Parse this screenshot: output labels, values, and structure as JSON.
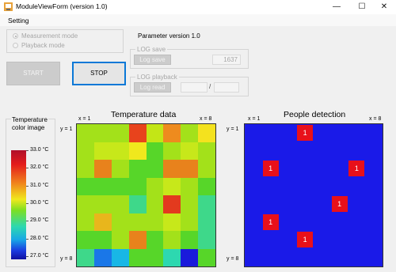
{
  "window": {
    "title": "ModuleViewForm (version 1.0)",
    "minimize": "—",
    "maximize": "☐",
    "close": "✕"
  },
  "menu": {
    "setting": "Setting"
  },
  "mode": {
    "measurement": "Measurement mode",
    "playback": "Playback mode",
    "selected": "measurement"
  },
  "buttons": {
    "start": "START",
    "stop": "STOP"
  },
  "parameter": {
    "version_label": "Parameter version 1.0"
  },
  "log_save": {
    "group": "LOG save",
    "button": "Log save",
    "value": "1637"
  },
  "log_playback": {
    "group": "LOG playback",
    "button": "Log read",
    "current": "",
    "separator": "/",
    "total": ""
  },
  "temperature": {
    "title": "Temperature data",
    "x_start": "x = 1",
    "x_end": "x = 8",
    "y_start": "y = 1",
    "y_end": "y = 8",
    "colors": [
      [
        "#a3e11a",
        "#a3e11a",
        "#a3e11a",
        "#e8431c",
        "#c3e616",
        "#ee8b1e",
        "#a3e11a",
        "#f4e21e"
      ],
      [
        "#a3e11a",
        "#c7e81a",
        "#c7e81a",
        "#f0e81d",
        "#57d629",
        "#a3e11a",
        "#c7e81a",
        "#a3e11a"
      ],
      [
        "#a3e11a",
        "#e8821c",
        "#a3e11a",
        "#57d629",
        "#57d629",
        "#e8821c",
        "#e8821c",
        "#a3e11a"
      ],
      [
        "#57d629",
        "#57d629",
        "#57d629",
        "#57d629",
        "#a3e11a",
        "#c7e81a",
        "#a3e11a",
        "#57d629"
      ],
      [
        "#a3e11a",
        "#a3e11a",
        "#a3e11a",
        "#3ed88a",
        "#a3e11a",
        "#e33a1e",
        "#a3e11a",
        "#3ed88a"
      ],
      [
        "#a3e11a",
        "#e8b61c",
        "#a3e11a",
        "#a3e11a",
        "#a3e11a",
        "#c7e81a",
        "#a3e11a",
        "#3ed88a"
      ],
      [
        "#57d629",
        "#57d629",
        "#a3e11a",
        "#e8821c",
        "#57d629",
        "#a3e11a",
        "#57d629",
        "#3ed88a"
      ],
      [
        "#3ed88a",
        "#1a77e8",
        "#18b7e6",
        "#57d629",
        "#57d629",
        "#2dd8b0",
        "#1a1adb",
        "#57d629"
      ]
    ]
  },
  "legend": {
    "title_line1": "Temperature",
    "title_line2": "color image",
    "ticks": [
      "33.0 °C",
      "32.0 °C",
      "31.0 °C",
      "30.0 °C",
      "29.0 °C",
      "28.0 °C",
      "27.0 °C"
    ]
  },
  "people": {
    "title": "People detection",
    "x_start": "x = 1",
    "x_end": "x = 8",
    "y_start": "y = 1",
    "y_end": "y = 8",
    "background": "#1a1ae8",
    "detections": [
      {
        "row": 1,
        "col": 4,
        "label": "1"
      },
      {
        "row": 3,
        "col": 2,
        "label": "1"
      },
      {
        "row": 3,
        "col": 7,
        "label": "1"
      },
      {
        "row": 5,
        "col": 6,
        "label": "1"
      },
      {
        "row": 6,
        "col": 2,
        "label": "1"
      },
      {
        "row": 7,
        "col": 4,
        "label": "1"
      }
    ]
  }
}
